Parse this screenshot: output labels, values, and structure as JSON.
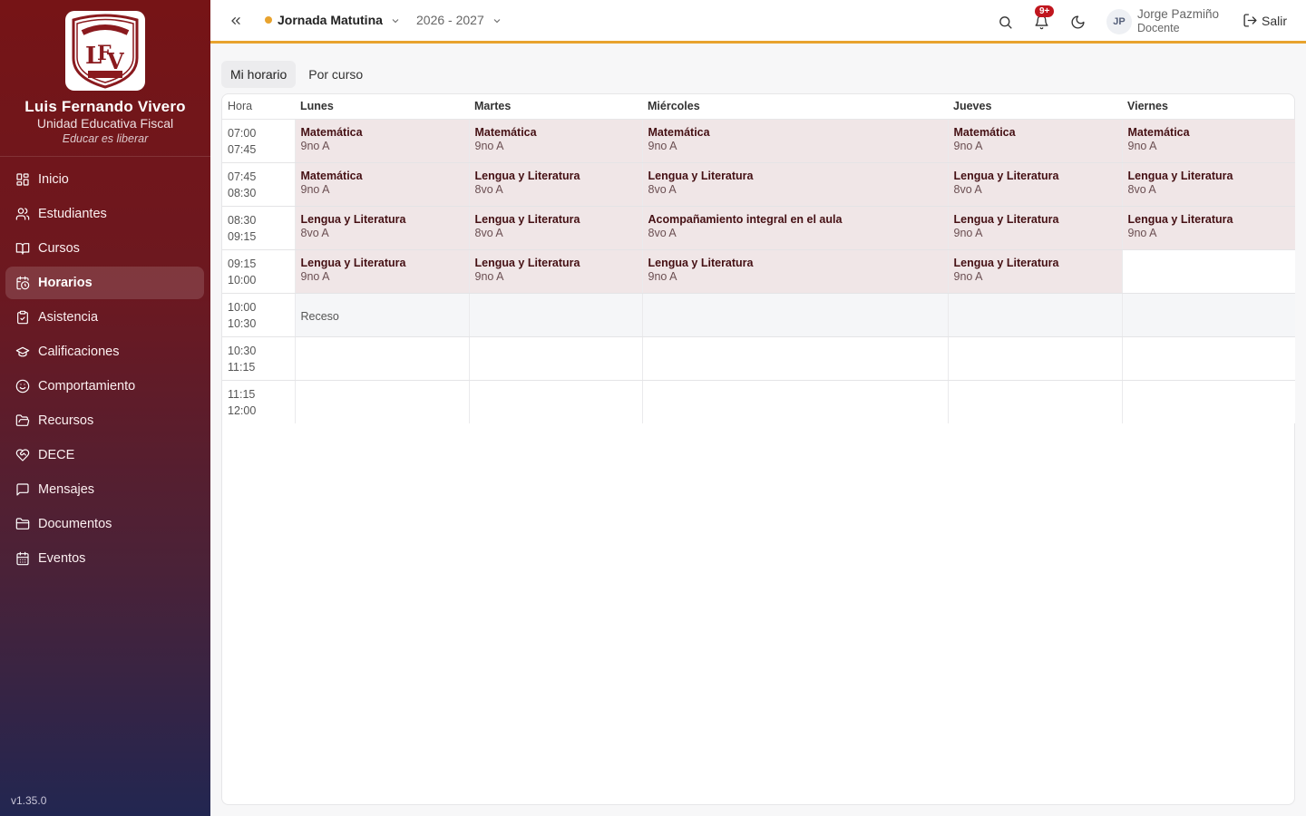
{
  "sidebar": {
    "logo_text": "LFV",
    "logo_motto": "EDUCAR ES LIBERAR",
    "logo_place": "POSORJA",
    "school_name": "Luis Fernando Vivero",
    "school_type": "Unidad Educativa Fiscal",
    "motto": "Educar es liberar",
    "items": [
      {
        "label": "Inicio",
        "icon": "dashboard-icon"
      },
      {
        "label": "Estudiantes",
        "icon": "users-icon"
      },
      {
        "label": "Cursos",
        "icon": "book-open-icon"
      },
      {
        "label": "Horarios",
        "icon": "calendar-clock-icon",
        "active": true
      },
      {
        "label": "Asistencia",
        "icon": "clipboard-check-icon"
      },
      {
        "label": "Calificaciones",
        "icon": "graduation-cap-icon"
      },
      {
        "label": "Comportamiento",
        "icon": "smile-icon"
      },
      {
        "label": "Recursos",
        "icon": "folder-open-icon"
      },
      {
        "label": "DECE",
        "icon": "heart-handshake-icon"
      },
      {
        "label": "Mensajes",
        "icon": "message-square-icon"
      },
      {
        "label": "Documentos",
        "icon": "folder-icon"
      },
      {
        "label": "Eventos",
        "icon": "calendar-icon"
      }
    ],
    "version": "v1.35.0"
  },
  "topbar": {
    "jornada": "Jornada Matutina",
    "year": "2026 - 2027",
    "notifications_badge": "9+",
    "user_initials": "JP",
    "user_name": "Jorge Pazmiño",
    "user_role": "Docente",
    "logout_label": "Salir",
    "accent_color": "#e8a32e"
  },
  "tabs": [
    {
      "label": "Mi horario",
      "active": true
    },
    {
      "label": "Por curso",
      "active": false
    }
  ],
  "schedule": {
    "headers": [
      "Hora",
      "Lunes",
      "Martes",
      "Miércoles",
      "Jueves",
      "Viernes"
    ],
    "rows": [
      {
        "start": "07:00",
        "end": "07:45",
        "cells": [
          {
            "subject": "Matemática",
            "course": "9no A"
          },
          {
            "subject": "Matemática",
            "course": "9no A"
          },
          {
            "subject": "Matemática",
            "course": "9no A"
          },
          {
            "subject": "Matemática",
            "course": "9no A"
          },
          {
            "subject": "Matemática",
            "course": "9no A"
          }
        ]
      },
      {
        "start": "07:45",
        "end": "08:30",
        "cells": [
          {
            "subject": "Matemática",
            "course": "9no A"
          },
          {
            "subject": "Lengua y Literatura",
            "course": "8vo A"
          },
          {
            "subject": "Lengua y Literatura",
            "course": "8vo A"
          },
          {
            "subject": "Lengua y Literatura",
            "course": "8vo A"
          },
          {
            "subject": "Lengua y Literatura",
            "course": "8vo A"
          }
        ]
      },
      {
        "start": "08:30",
        "end": "09:15",
        "cells": [
          {
            "subject": "Lengua y Literatura",
            "course": "8vo A"
          },
          {
            "subject": "Lengua y Literatura",
            "course": "8vo A"
          },
          {
            "subject": "Acompañamiento integral en el aula",
            "course": "8vo A"
          },
          {
            "subject": "Lengua y Literatura",
            "course": "9no A"
          },
          {
            "subject": "Lengua y Literatura",
            "course": "9no A"
          }
        ]
      },
      {
        "start": "09:15",
        "end": "10:00",
        "cells": [
          {
            "subject": "Lengua y Literatura",
            "course": "9no A"
          },
          {
            "subject": "Lengua y Literatura",
            "course": "9no A"
          },
          {
            "subject": "Lengua y Literatura",
            "course": "9no A"
          },
          {
            "subject": "Lengua y Literatura",
            "course": "9no A"
          },
          null
        ]
      },
      {
        "start": "10:00",
        "end": "10:30",
        "recess": true,
        "recess_label": "Receso",
        "cells": [
          null,
          null,
          null,
          null,
          null
        ]
      },
      {
        "start": "10:30",
        "end": "11:15",
        "cells": [
          null,
          null,
          null,
          null,
          null
        ]
      },
      {
        "start": "11:15",
        "end": "12:00",
        "cells": [
          null,
          null,
          null,
          null,
          null
        ]
      }
    ]
  }
}
